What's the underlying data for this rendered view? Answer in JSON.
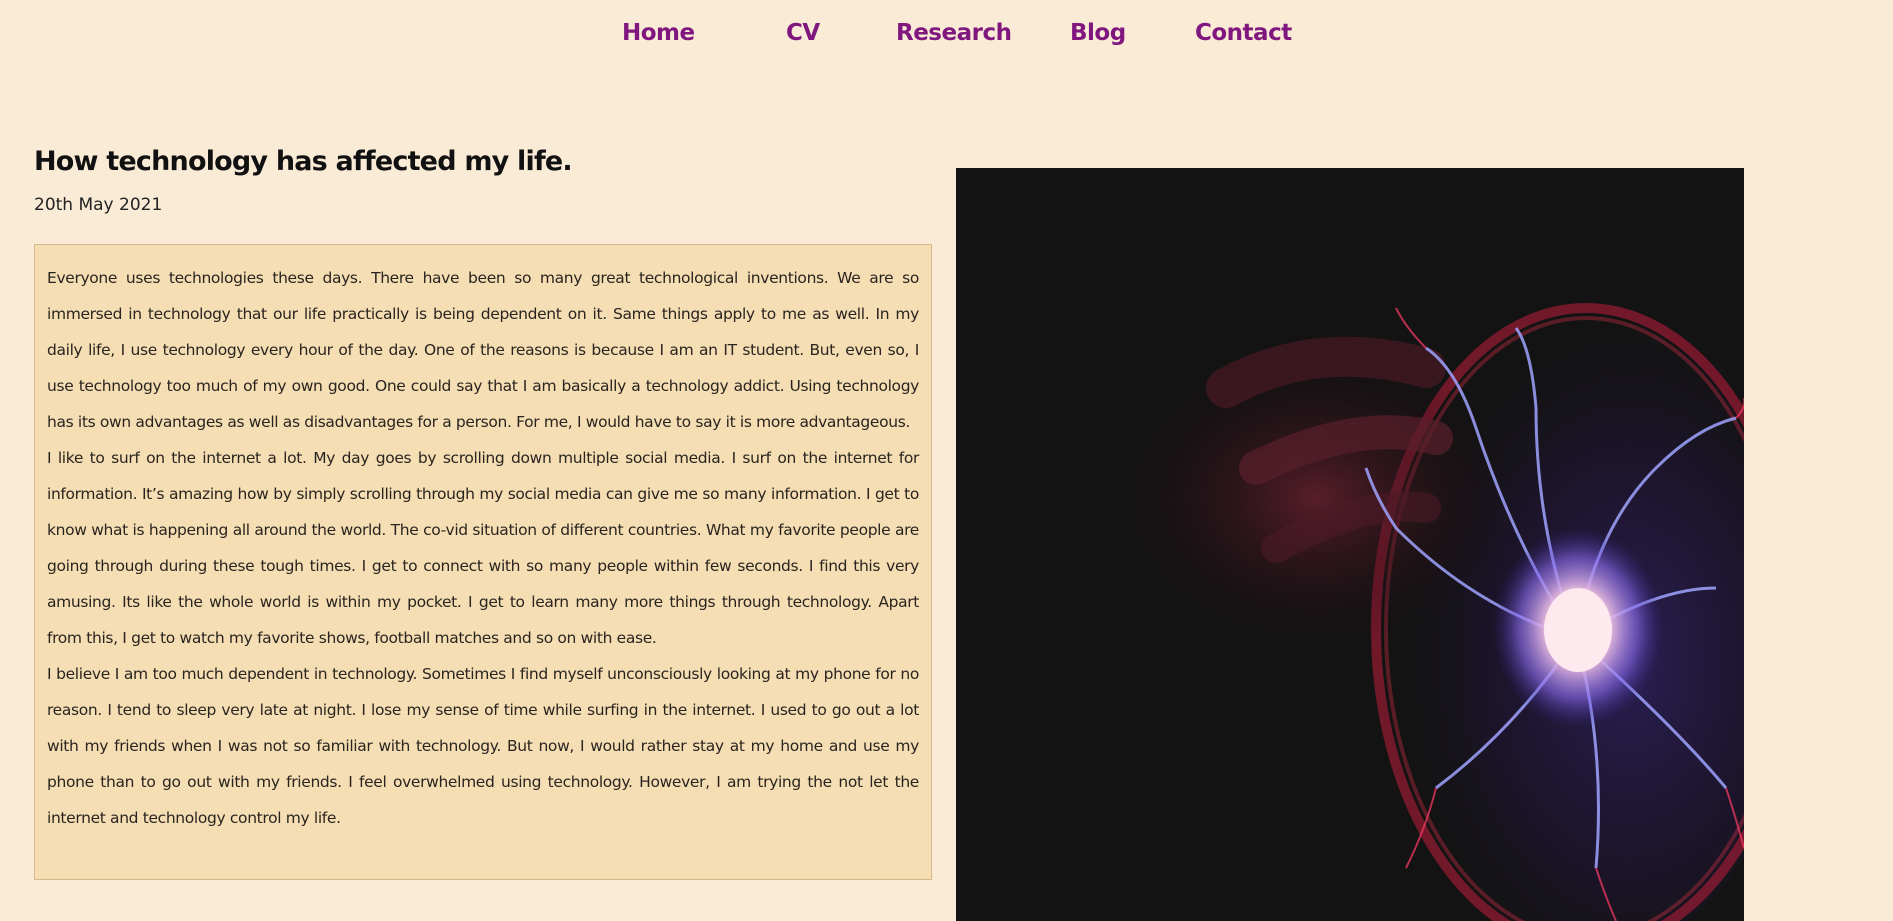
{
  "nav": {
    "home": "Home",
    "cv": "CV",
    "research": "Research",
    "blog": "Blog",
    "contact": "Contact"
  },
  "post": {
    "title": "How technology has affected my life.",
    "date": "20th May 2021",
    "paragraphs": [
      "Everyone uses technologies these days. There have been so many great technological inventions. We are so immersed in technology that our life practically is being dependent on it. Same things apply to me as well. In my daily life, I use technology every hour of the day. One of the reasons is because I am an IT student. But, even so, I use technology too much of my own good. One could say that I am basically a technology addict. Using technology has its own advantages as well as disadvantages for a person. For me, I would have to say it is more advantageous.",
      "I like to surf on the internet a lot. My day goes by scrolling down multiple social media. I surf on the internet for information. It’s amazing how by simply scrolling through my social media can give me so many information. I get to know what is happening all around the world. The co-vid situation of different countries. What my favorite people are going through during these tough times. I get to connect with so many people within few seconds. I find this very amusing. Its like the whole world is within my pocket. I get to learn many more things through technology. Apart from this, I get to watch my favorite shows, football matches and so on with ease.",
      "I believe I am too much dependent in technology. Sometimes I find myself unconsciously looking at my phone for no reason. I tend to sleep very late at night. I lose my sense of time while surfing in the internet. I used to go out a lot with my friends when I was not so familiar with technology. But now, I would rather stay at my home and use my phone than to go out with my friends. I feel overwhelmed using technology. However, I am trying the not let the internet and technology control my life."
    ]
  },
  "colors": {
    "background": "#faebd7",
    "nav_link": "#80177f",
    "text_box": "#f5deb3",
    "text_box_border": "#d8b887"
  },
  "image": {
    "icon": "plasma-ball-photo"
  }
}
